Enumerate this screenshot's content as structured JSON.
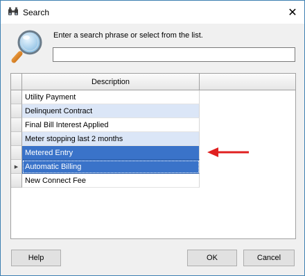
{
  "window": {
    "title": "Search",
    "close_glyph": "✕",
    "accent_border": "#3c7fb1"
  },
  "icons": {
    "title_icon": "binoculars-icon",
    "big_icon": "magnifier-icon"
  },
  "search": {
    "prompt": "Enter a search phrase or select from the list.",
    "value": ""
  },
  "grid": {
    "columns": [
      "Description"
    ],
    "rows": [
      {
        "label": "Utility Payment",
        "state": "normal"
      },
      {
        "label": "Delinquent Contract",
        "state": "alt"
      },
      {
        "label": "Final Bill Interest Applied",
        "state": "normal"
      },
      {
        "label": "Meter stopping last 2 months",
        "state": "alt"
      },
      {
        "label": "Metered Entry",
        "state": "selected"
      },
      {
        "label": "Automatic Billing",
        "state": "selected-current"
      },
      {
        "label": "New Connect Fee",
        "state": "normal"
      }
    ],
    "current_row_marker": "▶",
    "selection_color": "#3a73c9",
    "alt_row_color": "#dbe6f7"
  },
  "annotation": {
    "arrow_color": "#e02020"
  },
  "buttons": {
    "help": "Help",
    "ok": "OK",
    "cancel": "Cancel"
  }
}
